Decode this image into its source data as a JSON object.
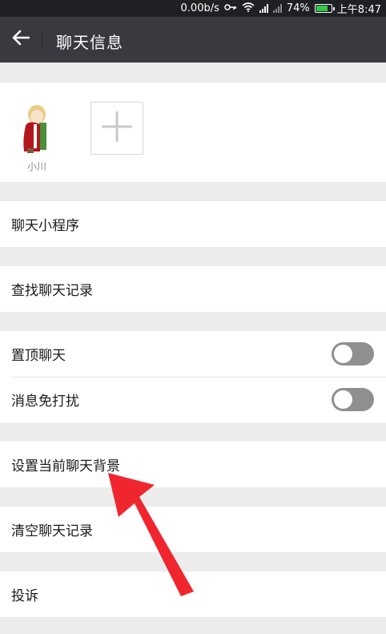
{
  "status_bar": {
    "speed": "0.00b/s",
    "battery_percent": "74%",
    "time": "上午8:47"
  },
  "header": {
    "title": "聊天信息",
    "back_icon": "arrow-left-icon"
  },
  "members": [
    {
      "name": "小川"
    }
  ],
  "add_member_icon": "plus-icon",
  "menu": {
    "mini_programs": "聊天小程序",
    "search_history": "查找聊天记录",
    "pin_chat": "置顶聊天",
    "mute_notifications": "消息免打扰",
    "set_background": "设置当前聊天背景",
    "clear_history": "清空聊天记录",
    "report": "投诉"
  },
  "toggles": {
    "pin_chat_on": false,
    "mute_on": false
  },
  "colors": {
    "header_bg": "#393a3f",
    "page_bg": "#ececed",
    "annotation_arrow": "#f0262e"
  }
}
